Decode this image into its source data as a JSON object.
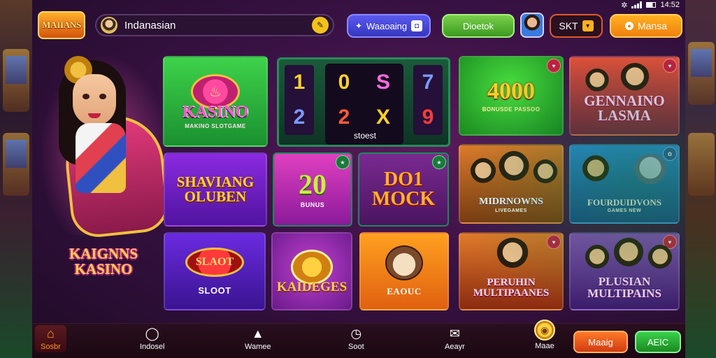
{
  "status_bar": {
    "time": "14:52"
  },
  "header": {
    "logo_text": "MAIIANS",
    "search_value": "Indanasian",
    "buttons": {
      "blue": "Waaoaing",
      "green": "Dioetok",
      "dark": "SKT",
      "orange": "Mansa"
    }
  },
  "hero": {
    "brand_line1": "KAIGNNS",
    "brand_line2": "KASINO"
  },
  "tiles": {
    "kasino": {
      "title": "KASINO",
      "sub": "MAKINO SLOTGAME"
    },
    "reels": {
      "col1": [
        "1",
        "2"
      ],
      "col2": [
        "0",
        "2"
      ],
      "col3": [
        "S",
        "X"
      ],
      "col4": [
        "7",
        "9"
      ],
      "label": "stoest"
    },
    "jackpot": {
      "title": "4000",
      "sub": "BONUSDE PASSOO"
    },
    "gennaino": {
      "title": "GENNAINO LASMA"
    },
    "shaviang": {
      "title": "SHAVIANG OLUBEN"
    },
    "twenty": {
      "title": "20",
      "sub": "BUNUS"
    },
    "moc": {
      "title": "DO1 MOCK"
    },
    "midrows": {
      "title": "MIDRNOWNS",
      "sub": "LIVEGAMES"
    },
    "fourdvons": {
      "title": "FOURDUIDVONS",
      "sub": "GAMES NEW"
    },
    "sloot": {
      "emblem": "SLAOT",
      "sub": "SLOOT"
    },
    "kaideges": {
      "title": "KAIDEGES"
    },
    "eaoc": {
      "sub": "EAOUC"
    },
    "peruhin": {
      "title": "PERUHIN MULTIPAANES"
    },
    "plusian": {
      "title": "PLUSIAN MULTIPAINS"
    }
  },
  "nav": {
    "items": [
      "Sosbr",
      "Indosel",
      "Wamee",
      "Soot",
      "Aeayr",
      "Maae"
    ],
    "btn_red": "Maaig",
    "btn_green": "AEIC"
  },
  "icons": {
    "home": "home-icon",
    "bulb": "lightbulb-icon",
    "house": "house-icon",
    "clock": "clock-icon",
    "mail": "mail-icon",
    "coin": "coin-icon"
  },
  "colors": {
    "accent": "#ff9a20",
    "brand_pink": "#e23a7a",
    "green": "#3ed24a"
  }
}
